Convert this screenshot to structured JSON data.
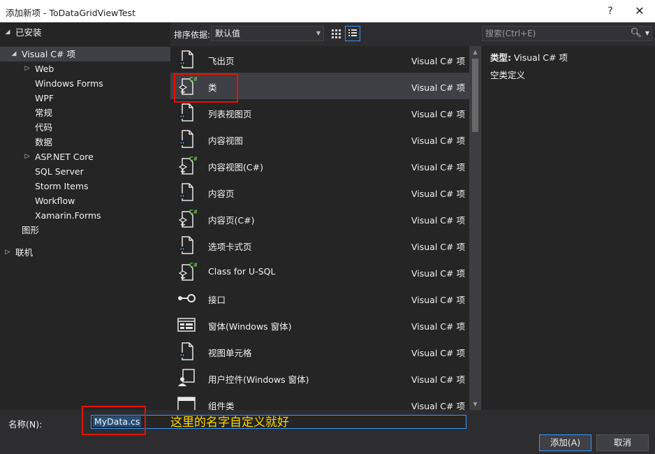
{
  "window": {
    "title": "添加新项 - ToDataGridViewTest",
    "help": "?",
    "close": "✕"
  },
  "tree": {
    "installed": "已安装",
    "visual_csharp": "Visual C# 项",
    "web": "Web",
    "winforms": "Windows Forms",
    "wpf": "WPF",
    "common": "常规",
    "code": "代码",
    "data": "数据",
    "aspnet": "ASP.NET Core",
    "sql": "SQL Server",
    "storm": "Storm Items",
    "workflow": "Workflow",
    "xamarin": "Xamarin.Forms",
    "graphics": "图形",
    "online": "联机"
  },
  "toolbar": {
    "sort_label": "排序依据:",
    "sort_value": "默认值",
    "search_placeholder": "搜索(Ctrl+E)"
  },
  "templates": [
    {
      "name": "飞出页",
      "lang": "Visual C# 项",
      "icon": "page-icon"
    },
    {
      "name": "类",
      "lang": "Visual C# 项",
      "icon": "csharp-class-icon"
    },
    {
      "name": "列表视图页",
      "lang": "Visual C# 项",
      "icon": "page-icon"
    },
    {
      "name": "内容视图",
      "lang": "Visual C# 项",
      "icon": "page-icon"
    },
    {
      "name": "内容视图(C#)",
      "lang": "Visual C# 项",
      "icon": "csharp-class-icon"
    },
    {
      "name": "内容页",
      "lang": "Visual C# 项",
      "icon": "page-icon"
    },
    {
      "name": "内容页(C#)",
      "lang": "Visual C# 项",
      "icon": "csharp-class-icon"
    },
    {
      "name": "选项卡式页",
      "lang": "Visual C# 项",
      "icon": "page-icon"
    },
    {
      "name": "Class for U-SQL",
      "lang": "Visual C# 项",
      "icon": "csharp-class-icon"
    },
    {
      "name": "接口",
      "lang": "Visual C# 项",
      "icon": "interface-icon"
    },
    {
      "name": "窗体(Windows 窗体)",
      "lang": "Visual C# 项",
      "icon": "form-icon"
    },
    {
      "name": "视图单元格",
      "lang": "Visual C# 项",
      "icon": "page-icon"
    },
    {
      "name": "用户控件(Windows 窗体)",
      "lang": "Visual C# 项",
      "icon": "user-control-icon"
    },
    {
      "name": "组件类",
      "lang": "Visual C# 项",
      "icon": "component-icon"
    }
  ],
  "details": {
    "type_label": "类型:",
    "type_value": "Visual C# 项",
    "description": "空类定义"
  },
  "bottom": {
    "name_label": "名称(N):",
    "name_value": "MyData.cs",
    "annotation": "这里的名字自定义就好",
    "add_button": "添加(A)",
    "cancel_button": "取消"
  },
  "colors": {
    "background": "#2d2d30",
    "panel": "#252526",
    "selection": "#3f3f46",
    "accent_blue": "#3399ff",
    "highlight_red": "#e51400",
    "annotation_yellow": "#ffd700"
  }
}
